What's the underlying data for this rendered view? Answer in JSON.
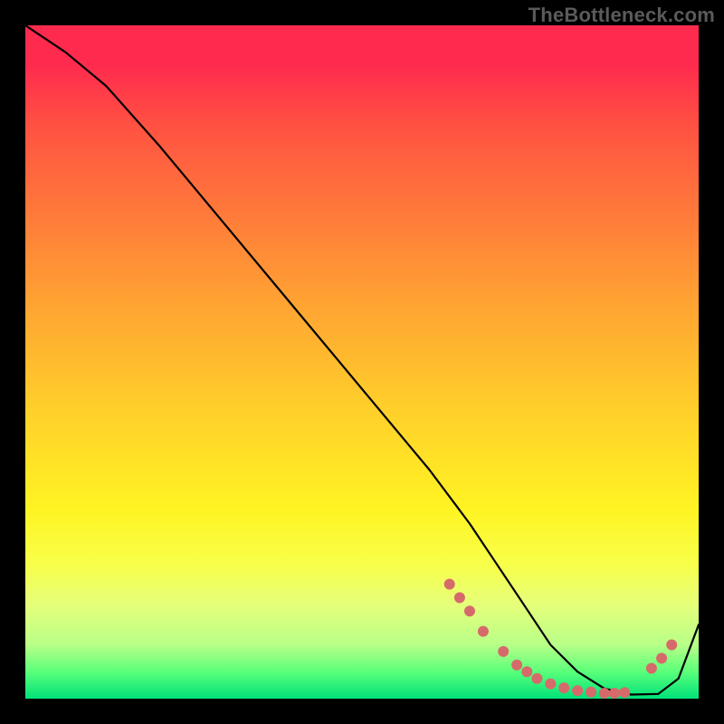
{
  "watermark": "TheBottleneck.com",
  "chart_data": {
    "type": "line",
    "title": "",
    "xlabel": "",
    "ylabel": "",
    "xlim": [
      0,
      100
    ],
    "ylim": [
      0,
      100
    ],
    "grid": false,
    "legend": false,
    "series": [
      {
        "name": "curve",
        "color": "#000000",
        "x": [
          0,
          6,
          12,
          20,
          30,
          40,
          50,
          60,
          66,
          70,
          74,
          78,
          82,
          86,
          90,
          94,
          97,
          100
        ],
        "y": [
          100,
          96,
          91,
          82,
          70,
          58,
          46,
          34,
          26,
          20,
          14,
          8,
          4,
          1.5,
          0.6,
          0.7,
          3,
          11
        ]
      }
    ],
    "markers": {
      "name": "dots",
      "color": "#d66a6a",
      "radius": 6,
      "x": [
        63,
        64.5,
        66,
        68,
        71,
        73,
        74.5,
        76,
        78,
        80,
        82,
        84,
        86,
        87.5,
        89,
        93,
        94.5,
        96
      ],
      "y": [
        17,
        15,
        13,
        10,
        7,
        5,
        4,
        3,
        2.2,
        1.6,
        1.2,
        1.0,
        0.8,
        0.8,
        0.9,
        4.5,
        6,
        8
      ]
    },
    "background_gradient": [
      {
        "stop": 0.0,
        "color": "#ff2b4e"
      },
      {
        "stop": 0.06,
        "color": "#ff2b4e"
      },
      {
        "stop": 0.15,
        "color": "#ff5242"
      },
      {
        "stop": 0.28,
        "color": "#ff7a3a"
      },
      {
        "stop": 0.42,
        "color": "#ffa532"
      },
      {
        "stop": 0.57,
        "color": "#ffcf2a"
      },
      {
        "stop": 0.72,
        "color": "#fff423"
      },
      {
        "stop": 0.8,
        "color": "#f8ff4a"
      },
      {
        "stop": 0.86,
        "color": "#e6ff7a"
      },
      {
        "stop": 0.92,
        "color": "#b8ff88"
      },
      {
        "stop": 0.96,
        "color": "#5aff7a"
      },
      {
        "stop": 1.0,
        "color": "#00e27a"
      }
    ]
  }
}
